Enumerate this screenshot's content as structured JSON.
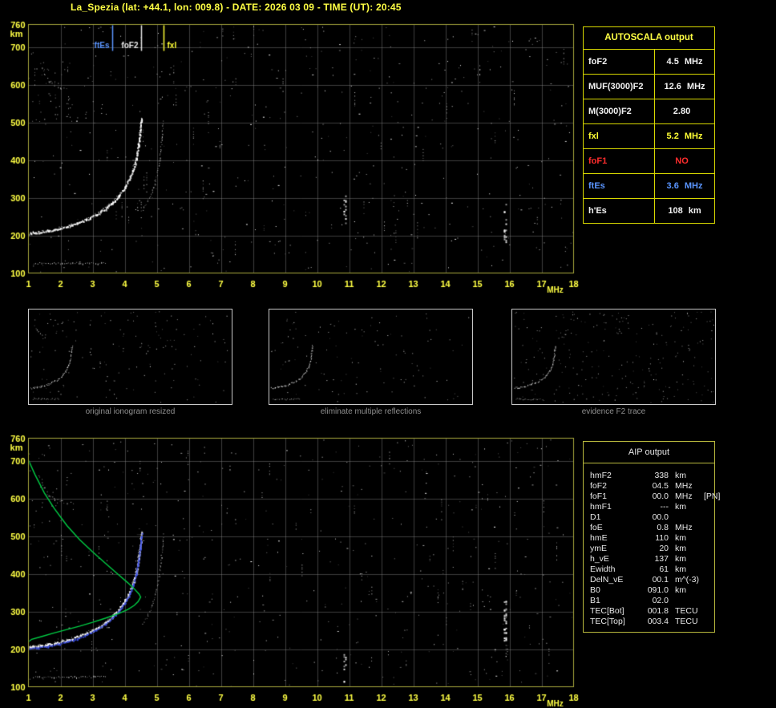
{
  "header": {
    "title": "La_Spezia (lat: +44.1, lon: 009.8) - DATE: 2026 03 09 - TIME (UT): 20:45"
  },
  "autoscala": {
    "title": "AUTOSCALA output",
    "rows": [
      {
        "label": "foF2",
        "value": "4.5",
        "unit": "MHz",
        "color": "#f2f2f2"
      },
      {
        "label": "MUF(3000)F2",
        "value": "12.6",
        "unit": "MHz",
        "color": "#f2f2f2"
      },
      {
        "label": "M(3000)F2",
        "value": "2.80",
        "unit": "",
        "color": "#f2f2f2"
      },
      {
        "label": "fxl",
        "value": "5.2",
        "unit": "MHz",
        "color": "#ffff35"
      },
      {
        "label": "foF1",
        "value": "NO",
        "unit": "",
        "color": "#ff2d2d"
      },
      {
        "label": "ftEs",
        "value": "3.6",
        "unit": "MHz",
        "color": "#5a95ff"
      },
      {
        "label": "h'Es",
        "value": "108",
        "unit": "km",
        "color": "#f2f2f2"
      }
    ]
  },
  "aip": {
    "title": "AIP output",
    "rows": [
      {
        "label": "hmF2",
        "value": "338",
        "unit": "km",
        "note": ""
      },
      {
        "label": "foF2",
        "value": "04.5",
        "unit": "MHz",
        "note": ""
      },
      {
        "label": "foF1",
        "value": "00.0",
        "unit": "MHz",
        "note": "[PN]"
      },
      {
        "label": "hmF1",
        "value": "---",
        "unit": "km",
        "note": ""
      },
      {
        "label": "D1",
        "value": "00.0",
        "unit": "",
        "note": ""
      },
      {
        "label": "foE",
        "value": "0.8",
        "unit": "MHz",
        "note": ""
      },
      {
        "label": "hmE",
        "value": "110",
        "unit": "km",
        "note": ""
      },
      {
        "label": "ymE",
        "value": "20",
        "unit": "km",
        "note": ""
      },
      {
        "label": "h_vE",
        "value": "137",
        "unit": "km",
        "note": ""
      },
      {
        "label": "Ewidth",
        "value": "61",
        "unit": "km",
        "note": ""
      },
      {
        "label": "DelN_vE",
        "value": "00.1",
        "unit": "m^(-3)",
        "note": ""
      },
      {
        "label": "B0",
        "value": "091.0",
        "unit": "km",
        "note": ""
      },
      {
        "label": "B1",
        "value": "02.0",
        "unit": "",
        "note": ""
      },
      {
        "label": "TEC[Bot]",
        "value": "001.8",
        "unit": "TECU",
        "note": ""
      },
      {
        "label": "TEC[Top]",
        "value": "003.4",
        "unit": "TECU",
        "note": ""
      }
    ]
  },
  "thumbnails": [
    {
      "caption": "original ionogram resized"
    },
    {
      "caption": "eliminate multiple reflections"
    },
    {
      "caption": "evidence F2 trace"
    }
  ],
  "chart_data": {
    "type": "scatter",
    "xlabel": "MHz",
    "ylabel": "km",
    "xlim": [
      1,
      18
    ],
    "ylim": [
      100,
      760
    ],
    "xticks": [
      1,
      2,
      3,
      4,
      5,
      6,
      7,
      8,
      9,
      10,
      11,
      12,
      13,
      14,
      15,
      16,
      17,
      18
    ],
    "yticks": [
      100,
      200,
      300,
      400,
      500,
      600,
      700,
      760
    ],
    "grid": true,
    "markers": [
      {
        "name": "ftEs",
        "f": 3.6,
        "color": "#5a95ff",
        "label_side": "left"
      },
      {
        "name": "foF2",
        "f": 4.5,
        "color": "#e8e8e8",
        "label_side": "left"
      },
      {
        "name": "fxl",
        "f": 5.2,
        "color": "#ffff35",
        "label_side": "right"
      }
    ],
    "o_trace": [
      [
        1.0,
        206
      ],
      [
        1.3,
        209
      ],
      [
        1.6,
        213
      ],
      [
        1.9,
        218
      ],
      [
        2.2,
        225
      ],
      [
        2.5,
        233
      ],
      [
        2.8,
        243
      ],
      [
        3.1,
        256
      ],
      [
        3.4,
        272
      ],
      [
        3.6,
        287
      ],
      [
        3.8,
        305
      ],
      [
        4.0,
        328
      ],
      [
        4.15,
        352
      ],
      [
        4.25,
        375
      ],
      [
        4.35,
        405
      ],
      [
        4.42,
        440
      ],
      [
        4.47,
        470
      ],
      [
        4.5,
        500
      ],
      [
        4.52,
        512
      ]
    ],
    "x_trace": [
      [
        4.55,
        270
      ],
      [
        4.7,
        290
      ],
      [
        4.85,
        315
      ],
      [
        4.95,
        345
      ],
      [
        5.05,
        385
      ],
      [
        5.12,
        430
      ],
      [
        5.17,
        470
      ],
      [
        5.2,
        505
      ]
    ],
    "second_hop": [
      [
        1.35,
        655
      ],
      [
        1.5,
        628
      ],
      [
        1.65,
        610
      ],
      [
        1.8,
        600
      ],
      [
        2.0,
        593
      ],
      [
        2.2,
        590
      ]
    ],
    "es_layer": {
      "height_km": 127,
      "f_start": 1.15,
      "f_end": 3.4
    },
    "spread": {
      "f": [
        1.0,
        2.4
      ],
      "km": [
        480,
        720
      ],
      "n": 26
    },
    "interference": {
      "top_chart": [
        {
          "f": 10.85,
          "km": [
            230,
            310
          ],
          "n": 14
        },
        {
          "f": 15.85,
          "km": [
            180,
            285
          ],
          "n": 18
        }
      ],
      "bottom_chart": [
        {
          "f": 10.85,
          "km": [
            110,
            210
          ],
          "n": 10
        },
        {
          "f": 15.85,
          "km": [
            220,
            335
          ],
          "n": 28
        }
      ]
    },
    "profile": {
      "color": "#00cc44",
      "topside": [
        [
          1.0,
          702
        ],
        [
          1.2,
          664
        ],
        [
          1.5,
          614
        ],
        [
          1.8,
          574
        ],
        [
          2.2,
          528
        ],
        [
          2.6,
          490
        ],
        [
          3.0,
          458
        ],
        [
          3.4,
          428
        ],
        [
          3.8,
          398
        ],
        [
          4.1,
          376
        ],
        [
          4.3,
          360
        ],
        [
          4.45,
          346
        ],
        [
          4.5,
          338
        ]
      ],
      "bottomside": [
        [
          4.5,
          338
        ],
        [
          4.42,
          326
        ],
        [
          4.3,
          316
        ],
        [
          4.1,
          305
        ],
        [
          3.8,
          294
        ],
        [
          3.4,
          282
        ],
        [
          3.0,
          271
        ],
        [
          2.6,
          261
        ],
        [
          2.2,
          252
        ],
        [
          1.8,
          243
        ],
        [
          1.4,
          233
        ],
        [
          1.1,
          226
        ],
        [
          0.98,
          218
        ],
        [
          0.95,
          208
        ]
      ]
    },
    "fitted_trace": {
      "color": "#3c50eb",
      "foF2_mhz": 4.5,
      "hmF2_km": 338
    }
  }
}
